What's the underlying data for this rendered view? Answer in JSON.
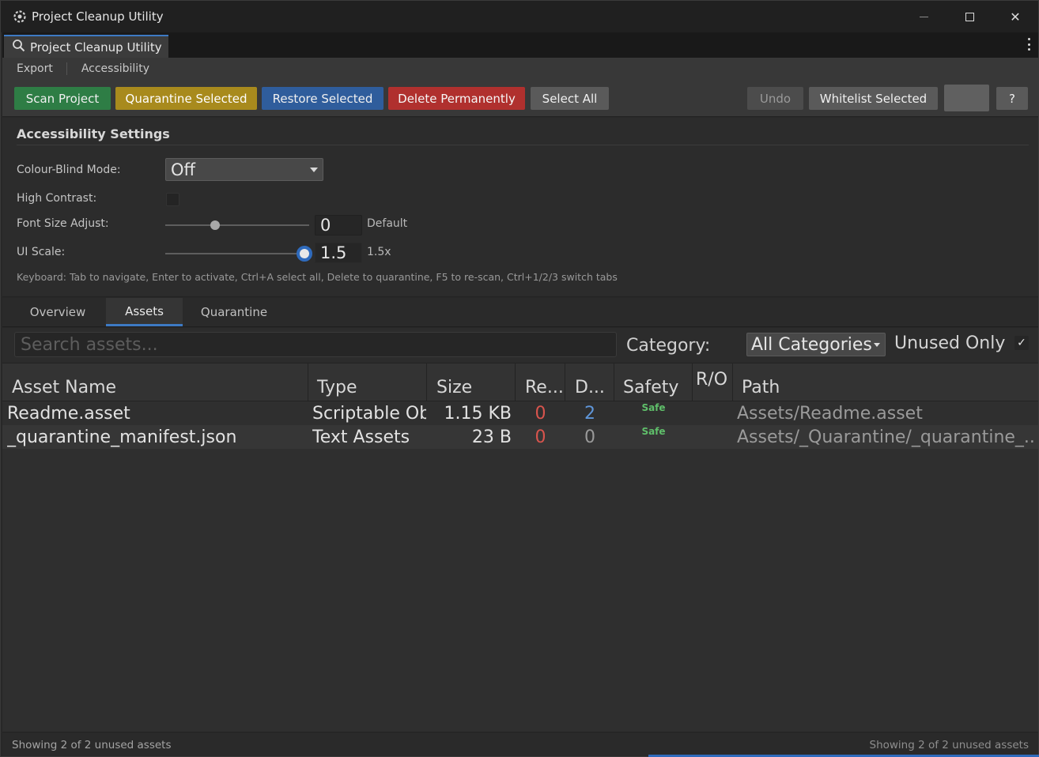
{
  "window": {
    "title": "Project Cleanup Utility",
    "controls": {
      "minimize": "minimize",
      "maximize": "maximize",
      "close": "✕"
    }
  },
  "editor_tab": {
    "label": "Project Cleanup Utility"
  },
  "menubar": {
    "items": [
      "Export",
      "Accessibility"
    ]
  },
  "toolbar": {
    "scan": "Scan Project",
    "quarantine": "Quarantine Selected",
    "restore": "Restore Selected",
    "delete": "Delete Permanently",
    "select_all": "Select All",
    "undo": "Undo",
    "whitelist": "Whitelist Selected",
    "blank": "",
    "help": "?"
  },
  "accessibility": {
    "title": "Accessibility Settings",
    "colour_blind_label": "Colour-Blind Mode:",
    "colour_blind_value": "Off",
    "high_contrast_label": "High Contrast:",
    "high_contrast_checked": false,
    "font_size_label": "Font Size Adjust:",
    "font_size_value": "0",
    "font_size_hint": "Default",
    "ui_scale_label": "UI Scale:",
    "ui_scale_value": "1.5",
    "ui_scale_hint": "1.5x",
    "keyboard_hint": "Keyboard: Tab to navigate, Enter to activate, Ctrl+A select all, Delete to quarantine, F5 to re-scan, Ctrl+1/2/3 switch tabs"
  },
  "view_tabs": [
    {
      "label": "Overview",
      "active": false
    },
    {
      "label": "Assets",
      "active": true
    },
    {
      "label": "Quarantine",
      "active": false
    }
  ],
  "filters": {
    "search_placeholder": "Search assets...",
    "search_value": "",
    "category_label": "Category:",
    "category_value": "All Categories",
    "unused_only_label": "Unused Only",
    "unused_only_checked": true,
    "check_glyph": "✓"
  },
  "table": {
    "columns": [
      "Asset Name",
      "Type",
      "Size",
      "Re...",
      "D...",
      "Safety",
      "R/O",
      "Path"
    ],
    "rows": [
      {
        "name": "Readme.asset",
        "type": "Scriptable Ob",
        "size": "1.15 KB",
        "refs": "0",
        "deps": "2",
        "safety": "Safe",
        "ro": "",
        "path": "Assets/Readme.asset"
      },
      {
        "name": "_quarantine_manifest.json",
        "type": "Text Assets",
        "size": "23 B",
        "refs": "0",
        "deps": "0",
        "safety": "Safe",
        "ro": "",
        "path": "Assets/_Quarantine/_quarantine_..."
      }
    ]
  },
  "status": {
    "left": "Showing 2 of 2 unused assets",
    "right": "Showing 2 of 2 unused assets"
  },
  "colors": {
    "accent": "#3d7ac4",
    "scan_button": "#2e7d45",
    "quarantine_button": "#a88a1d",
    "restore_button": "#2f5d9c",
    "delete_button": "#b0302e",
    "safe_text": "#5fbf6a",
    "refs_text": "#d8544d",
    "deps_text": "#5f96d9"
  },
  "icons": {
    "app": "unity-cog-icon",
    "editor_tab": "search-icon",
    "kebab": "more-vertical-icon"
  }
}
